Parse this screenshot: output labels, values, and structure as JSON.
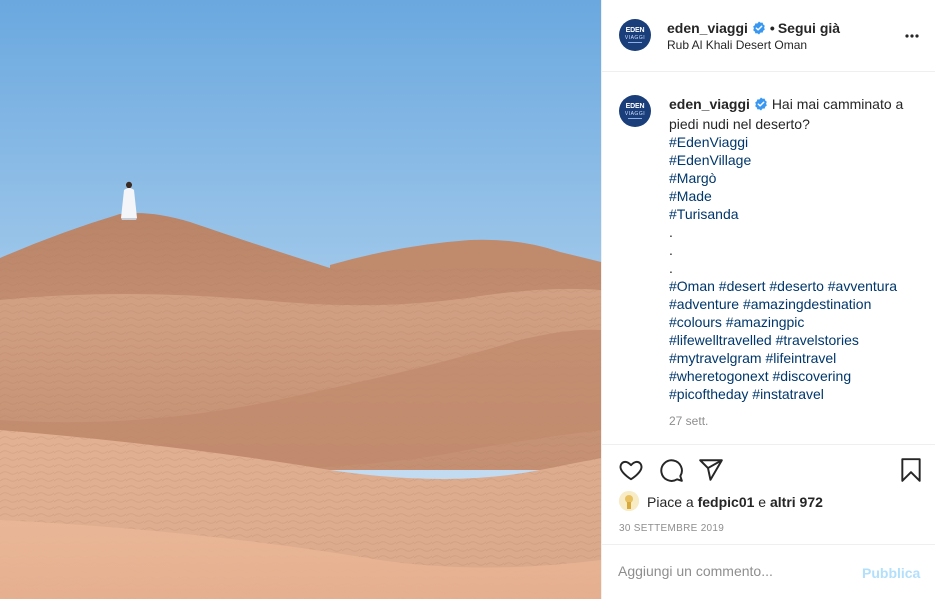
{
  "post": {
    "image_alt": "Persona in tunica bianca sulle dune di sabbia rosa del deserto"
  },
  "header": {
    "username": "eden_viaggi",
    "separator": "•",
    "follow_label": "Segui già",
    "location": "Rub Al Khali Desert Oman",
    "avatar_text_top": "EDEN",
    "avatar_text_bottom": "VIAGGI"
  },
  "caption": {
    "username": "eden_viaggi",
    "text": "Hai mai camminato a piedi nudi nel deserto?",
    "tags_lines": [
      "#EdenViaggi",
      "#EdenVillage",
      "#Margò",
      "#Made",
      "#Turisanda"
    ],
    "dots": [
      ".",
      ".",
      "."
    ],
    "tag_lines_2": [
      "#Oman #desert #deserto #avventura",
      "#adventure #amazingdestination",
      "#colours #amazingpic",
      "#lifewelltravelled #travelstories",
      "#mytravelgram #lifeintravel",
      "#wheretogonext #discovering",
      "#picoftheday #instatravel"
    ],
    "time": "27 sett."
  },
  "actions": {
    "likes_prefix": "Piace a",
    "likes_user": "fedpic01",
    "likes_middle": "e",
    "likes_others": "altri 972",
    "date": "30 SETTEMBRE 2019"
  },
  "comment": {
    "placeholder": "Aggiungi un commento...",
    "post_label": "Pubblica"
  },
  "colors": {
    "link": "#00376b",
    "verified": "#3897f0",
    "muted": "#8e8e8e",
    "post_disabled": "#b2dffc"
  },
  "icons": [
    "more-icon",
    "verified-icon",
    "heart-icon",
    "comment-icon",
    "share-icon",
    "bookmark-icon"
  ]
}
